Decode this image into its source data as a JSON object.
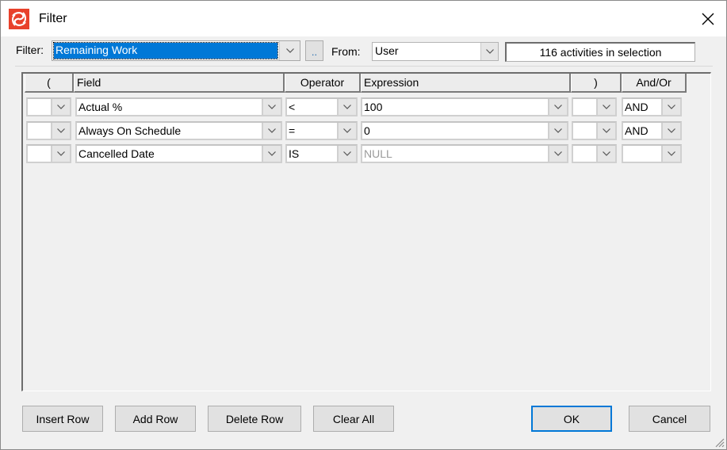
{
  "window": {
    "title": "Filter",
    "icon": "app-logo-icon",
    "close_icon": "close-icon",
    "brand_color": "#e8412b"
  },
  "toolbar": {
    "filter_label": "Filter:",
    "filter_value": "Remaining Work",
    "browse_label": "..",
    "from_label": "From:",
    "from_value": "User",
    "selection_count": "116 activities in selection"
  },
  "grid": {
    "columns": [
      "(",
      "Field",
      "Operator",
      "Expression",
      ")",
      "And/Or"
    ],
    "rows": [
      {
        "open_paren": "",
        "field": "Actual %",
        "operator": "<",
        "expression": "100",
        "close_paren": "",
        "and_or": "AND"
      },
      {
        "open_paren": "",
        "field": "Always On Schedule",
        "operator": "=",
        "expression": "0",
        "close_paren": "",
        "and_or": "AND"
      },
      {
        "open_paren": "",
        "field": "Cancelled Date",
        "operator": "IS",
        "expression": "NULL",
        "close_paren": "",
        "and_or": ""
      }
    ]
  },
  "buttons": {
    "insert_row": "Insert Row",
    "add_row": "Add Row",
    "delete_row": "Delete Row",
    "clear_all": "Clear All",
    "ok": "OK",
    "cancel": "Cancel"
  },
  "colors": {
    "selection_highlight": "#0078d7",
    "default_button_border": "#0078d7",
    "null_text": "#9a9a9a"
  }
}
